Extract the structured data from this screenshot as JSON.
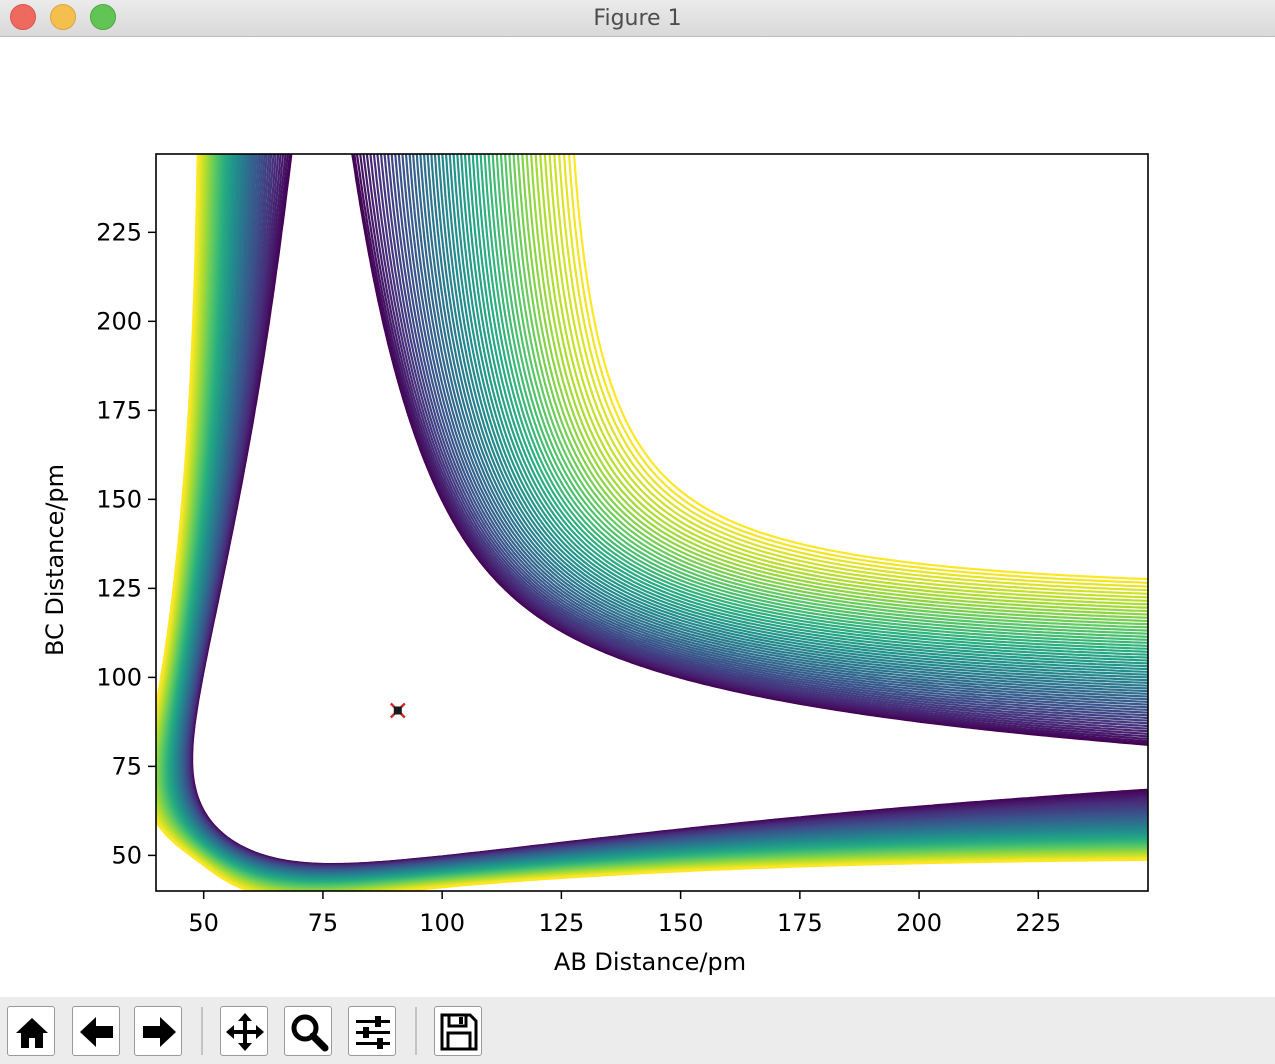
{
  "window": {
    "title": "Figure 1"
  },
  "toolbar": {
    "buttons": [
      {
        "name": "home",
        "icon": "home-icon"
      },
      {
        "name": "back",
        "icon": "arrow-left-icon"
      },
      {
        "name": "forward",
        "icon": "arrow-right-icon"
      },
      {
        "name": "pan",
        "icon": "move-icon"
      },
      {
        "name": "zoom",
        "icon": "zoom-icon"
      },
      {
        "name": "configure-subplots",
        "icon": "sliders-icon"
      },
      {
        "name": "save",
        "icon": "floppy-icon"
      }
    ]
  },
  "chart_data": {
    "type": "contour",
    "title": "",
    "xlabel": "AB Distance/pm",
    "ylabel": "BC Distance/pm",
    "xlim": [
      40,
      248
    ],
    "ylim": [
      40,
      247
    ],
    "xticks": [
      50,
      75,
      100,
      125,
      150,
      175,
      200,
      225
    ],
    "yticks": [
      50,
      75,
      100,
      125,
      150,
      175,
      200,
      225
    ],
    "colormap": "viridis",
    "colormap_stops": [
      "#440154",
      "#472d7b",
      "#3b528b",
      "#2c728e",
      "#21918c",
      "#28ae80",
      "#5ec962",
      "#addc30",
      "#fde725"
    ],
    "surface": "symmetric potential energy surface, minima along r_AB≈74 and r_BC≈74, saddle point near (91, 91)",
    "marker": {
      "x": 90.7,
      "y": 90.7,
      "symbol": "x",
      "color": "#d62728"
    },
    "grid": false,
    "legend": "none"
  }
}
